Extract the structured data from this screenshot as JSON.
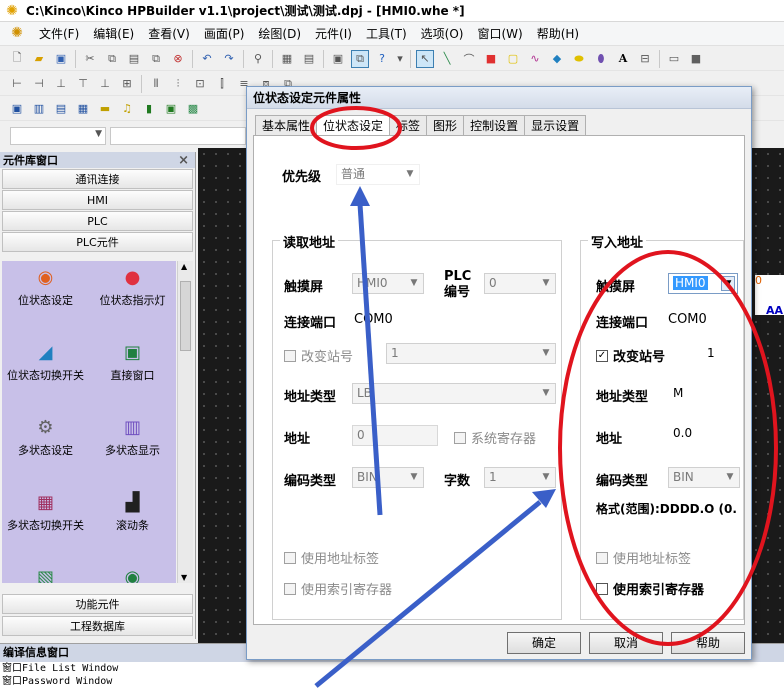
{
  "window": {
    "title": "C:\\Kinco\\Kinco HPBuilder v1.1\\project\\测试\\测试.dpj - [HMI0.whe *]"
  },
  "menu": [
    "文件(F)",
    "编辑(E)",
    "查看(V)",
    "画面(P)",
    "绘图(D)",
    "元件(I)",
    "工具(T)",
    "选项(O)",
    "窗口(W)",
    "帮助(H)"
  ],
  "left_panel": {
    "title": "元件库窗口",
    "close": "×",
    "categories": [
      "通讯连接",
      "HMI",
      "PLC",
      "PLC元件"
    ],
    "items": [
      "位状态设定",
      "位状态指示灯",
      "位状态切换开关",
      "直接窗口",
      "多状态设定",
      "多状态显示",
      "多状态切换开关",
      "滚动条",
      "",
      ""
    ],
    "bottom": [
      "功能元件",
      "工程数据库"
    ]
  },
  "compile": {
    "title": "编译信息窗口",
    "lines": [
      "窗口File List Window",
      "窗口Password Window"
    ]
  },
  "canvas": {
    "aa_text": "AA",
    "edge_text": "0"
  },
  "dialog": {
    "title": "位状态设定元件属性",
    "tabs": [
      "基本属性",
      "位状态设定",
      "标签",
      "图形",
      "控制设置",
      "显示设置"
    ],
    "priority": {
      "label": "优先级",
      "value": "普通"
    },
    "read": {
      "title": "读取地址",
      "touch_label": "触摸屏",
      "touch_value": "HMI0",
      "plc_label_1": "PLC",
      "plc_label_2": "编号",
      "plc_value": "0",
      "port_label": "连接端口",
      "port_value": "COM0",
      "station_label": "改变站号",
      "station_value": "1",
      "addr_type_label": "地址类型",
      "addr_type_value": "LB",
      "addr_label": "地址",
      "addr_value": "0",
      "sys_reg_label": "系统寄存器",
      "code_label": "编码类型",
      "code_value": "BIN",
      "words_label": "字数",
      "words_value": "1",
      "use_tag_label": "使用地址标签",
      "use_index_label": "使用索引寄存器"
    },
    "write": {
      "title": "写入地址",
      "touch_label": "触摸屏",
      "touch_value": "HMI0",
      "port_label": "连接端口",
      "port_value": "COM0",
      "station_label": "改变站号",
      "station_value": "1",
      "station_checked": "✓",
      "addr_type_label": "地址类型",
      "addr_type_value": "M",
      "addr_label": "地址",
      "addr_value": "0.0",
      "code_label": "编码类型",
      "code_value": "BIN",
      "format_label": "格式(范围):DDDD.O (0.",
      "use_tag_label": "使用地址标签",
      "use_index_label": "使用索引寄存器"
    },
    "buttons": {
      "ok": "确定",
      "cancel": "取消",
      "help": "帮助"
    }
  },
  "colors": {
    "annotation_red": "#e0141e",
    "annotation_blue": "#3a5fc8",
    "component_bg": "#c8c0e8"
  }
}
